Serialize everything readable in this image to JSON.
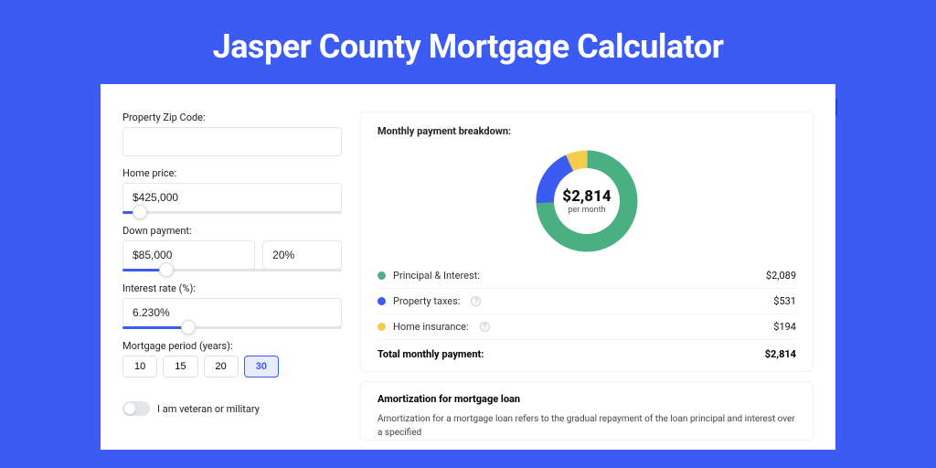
{
  "title": "Jasper County Mortgage Calculator",
  "form": {
    "zip_label": "Property Zip Code:",
    "zip_value": "",
    "price_label": "Home price:",
    "price_value": "$425,000",
    "price_slider_pct": 8,
    "down_label": "Down payment:",
    "down_value": "$85,000",
    "down_pct_value": "20%",
    "down_slider_pct": 20,
    "rate_label": "Interest rate (%):",
    "rate_value": "6.230%",
    "rate_slider_pct": 30,
    "period_label": "Mortgage period (years):",
    "periods": [
      "10",
      "15",
      "20",
      "30"
    ],
    "period_active": "30",
    "veteran_label": "I am veteran or military"
  },
  "breakdown": {
    "title": "Monthly payment breakdown:",
    "center_amount": "$2,814",
    "center_sub": "per month",
    "items": [
      {
        "label": "Principal & Interest:",
        "value": "$2,089",
        "color": "#4ab084",
        "info": false
      },
      {
        "label": "Property taxes:",
        "value": "$531",
        "color": "#3b5bf2",
        "info": true
      },
      {
        "label": "Home insurance:",
        "value": "$194",
        "color": "#f3cc4a",
        "info": true
      }
    ],
    "total_label": "Total monthly payment:",
    "total_value": "$2,814"
  },
  "chart_data": {
    "type": "pie",
    "title": "Monthly payment breakdown",
    "series": [
      {
        "name": "Principal & Interest",
        "value": 2089,
        "color": "#4ab084"
      },
      {
        "name": "Property taxes",
        "value": 531,
        "color": "#3b5bf2"
      },
      {
        "name": "Home insurance",
        "value": 194,
        "color": "#f3cc4a"
      }
    ],
    "total": 2814
  },
  "amort": {
    "title": "Amortization for mortgage loan",
    "text": "Amortization for a mortgage loan refers to the gradual repayment of the loan principal and interest over a specified"
  }
}
